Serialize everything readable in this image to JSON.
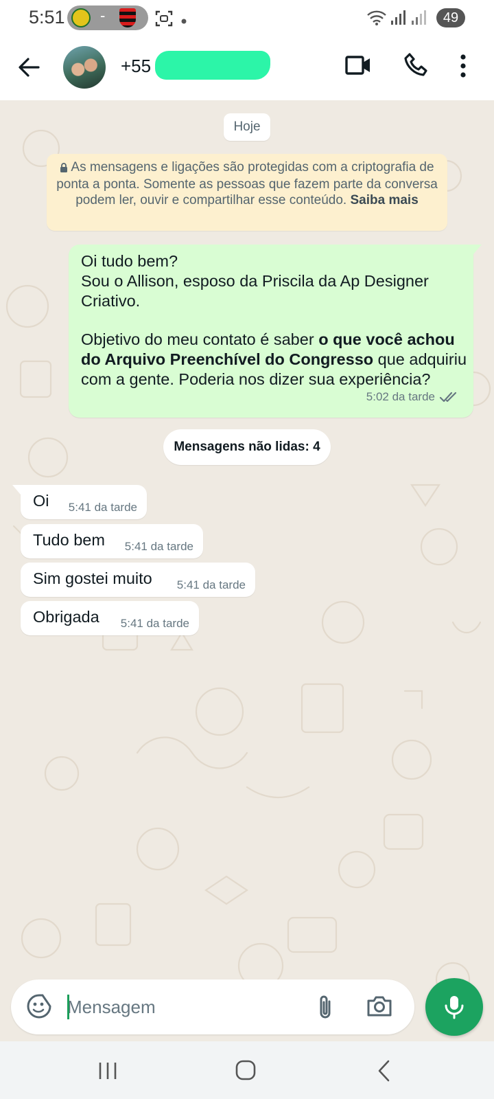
{
  "status_bar": {
    "time": "5:51",
    "pill_separator": "-",
    "battery": "49"
  },
  "header": {
    "contact_name": "+55"
  },
  "chat": {
    "date_chip": "Hoje",
    "e2e_notice": {
      "text": "As mensagens e ligações são protegidas com a criptografia de ponta a ponta. Somente as pessoas que fazem parte da conversa podem ler, ouvir e compartilhar esse conteúdo.",
      "link": "Saiba mais"
    },
    "outgoing": {
      "line1": "Oi tudo bem?",
      "line2": "Sou o Allison, esposo da Priscila da Ap Designer",
      "line3": "Criativo.",
      "line4_a": "Objetivo do meu contato é saber ",
      "line4_b": "o que você achou",
      "line5_a": "do Arquivo Preenchível do Congresso",
      "line5_b": " que adquiriu",
      "line6": "com a gente. Poderia nos dizer sua experiência?",
      "time": "5:02 da tarde",
      "status": "read"
    },
    "unread_label": "Mensagens não lidas: 4",
    "incoming": [
      {
        "text": "Oi",
        "time": "5:41 da tarde"
      },
      {
        "text": "Tudo bem",
        "time": "5:41 da tarde"
      },
      {
        "text": "Sim gostei muito",
        "time": "5:41 da tarde"
      },
      {
        "text": "Obrigada",
        "time": "5:41 da tarde"
      }
    ]
  },
  "composer": {
    "placeholder": "Mensagem"
  },
  "colors": {
    "accent": "#1ca360",
    "outgoing_bubble": "#d9fdd3",
    "incoming_bubble": "#ffffff",
    "notice_bg": "#fdf0cf",
    "chat_bg": "#efeae2",
    "read_ticks": "#667781"
  },
  "icons": [
    "back-arrow-icon",
    "video-call-icon",
    "phone-icon",
    "more-vert-icon",
    "lock-icon",
    "double-check-icon",
    "sticker-icon",
    "attach-icon",
    "camera-icon",
    "mic-icon",
    "recents-icon",
    "home-icon",
    "nav-back-icon",
    "wifi-icon",
    "signal-icon",
    "scan-icon"
  ]
}
